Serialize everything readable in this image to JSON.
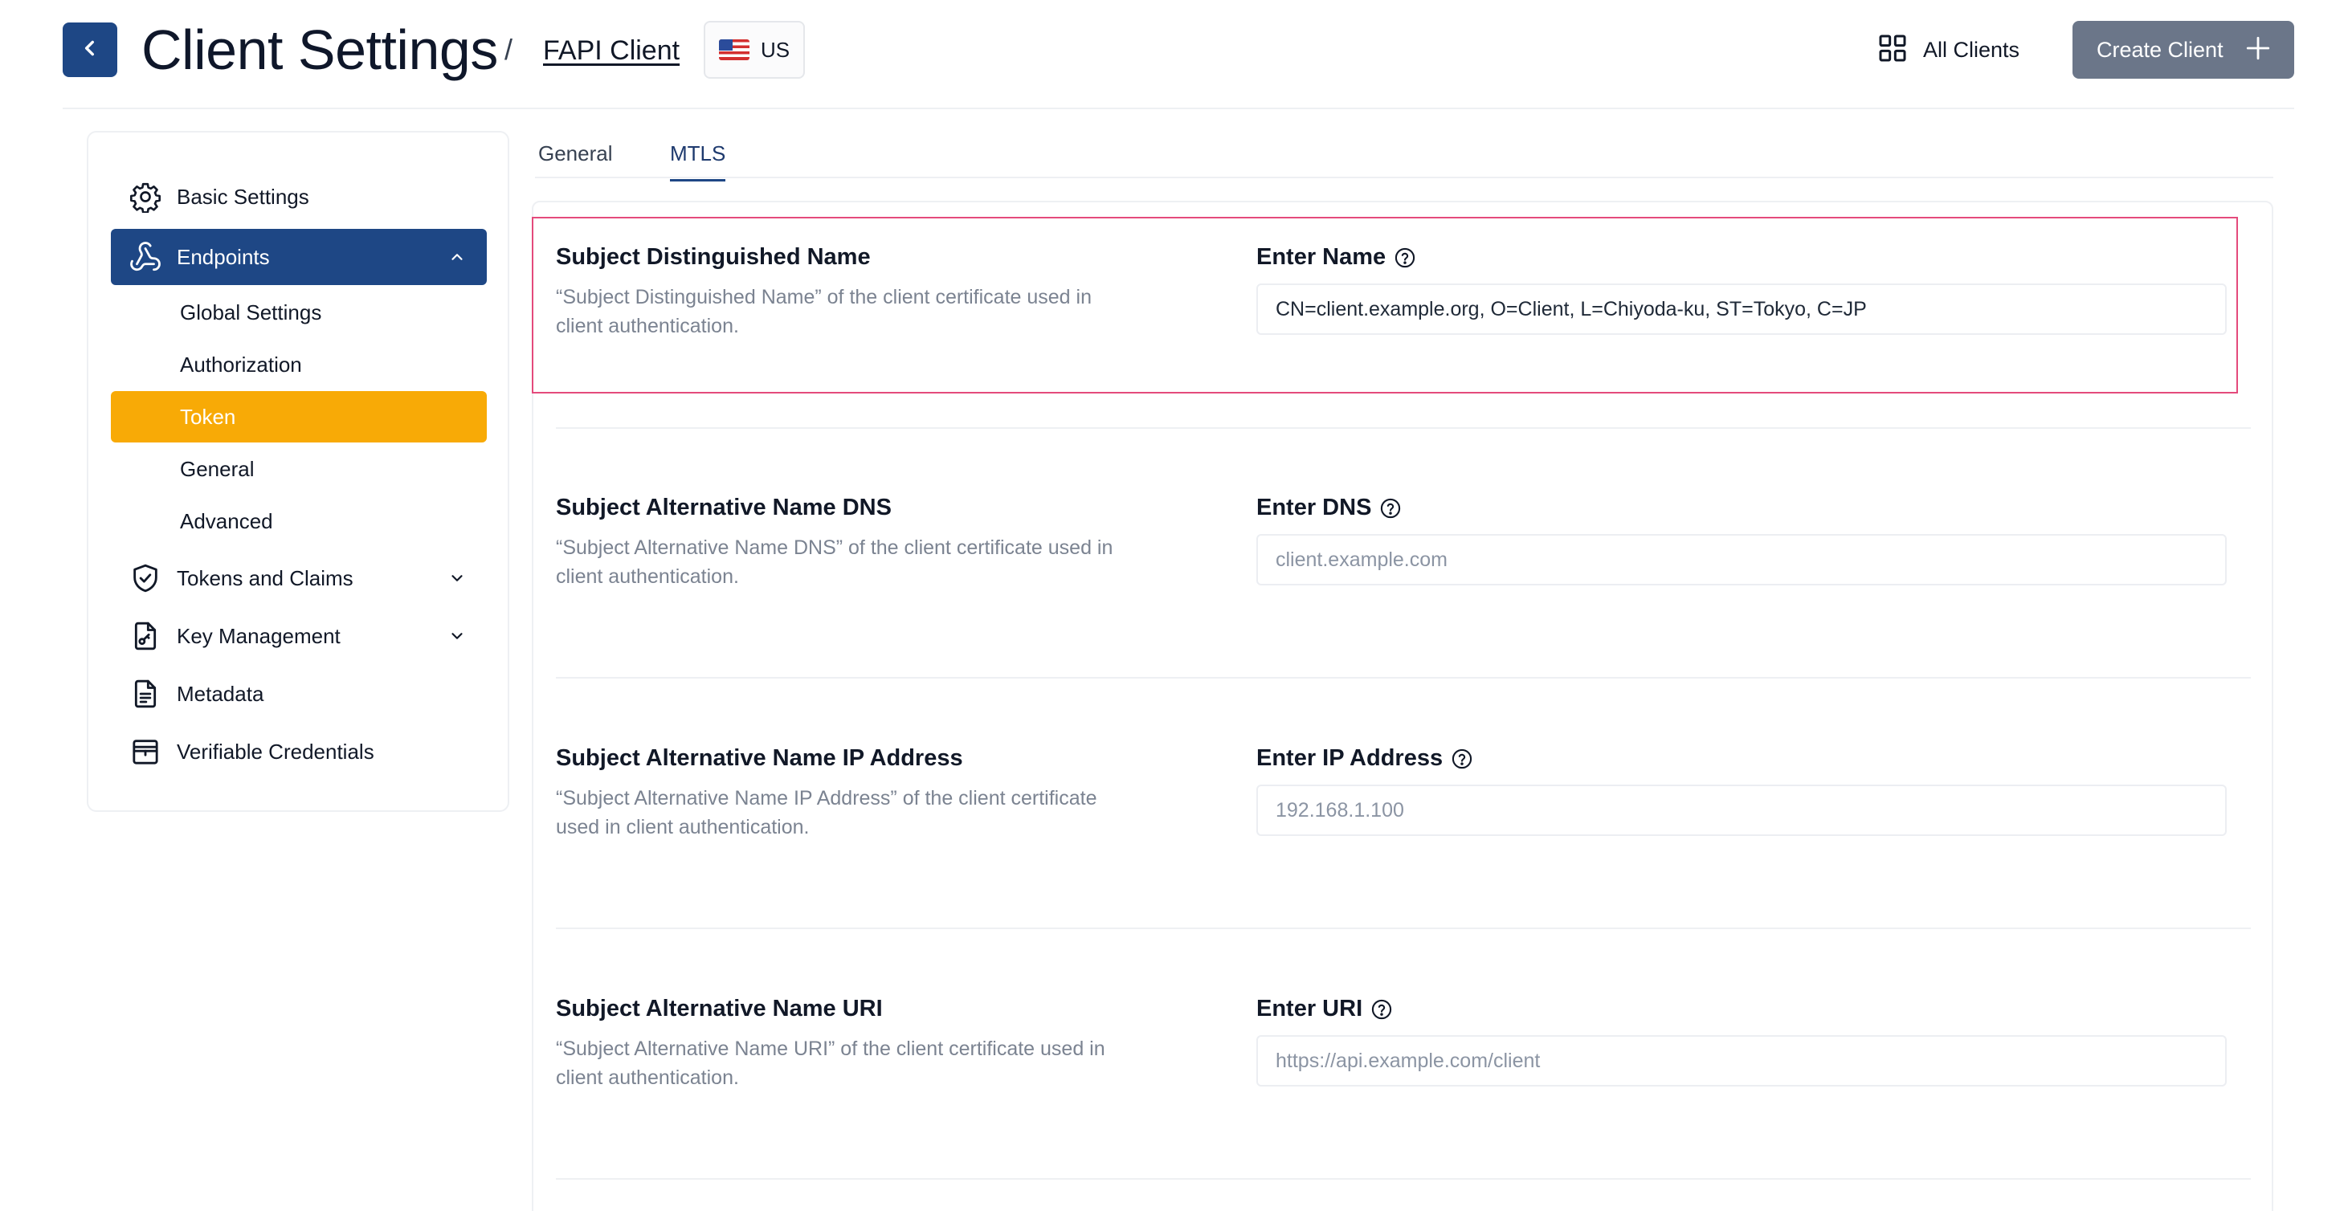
{
  "header": {
    "title": "Client Settings",
    "separator": "/",
    "client_name": "FAPI Client",
    "region": "US",
    "all_clients_label": "All Clients",
    "create_client_label": "Create Client"
  },
  "sidebar": {
    "basic_settings": "Basic Settings",
    "endpoints": "Endpoints",
    "endpoint_items": [
      "Global Settings",
      "Authorization",
      "Token",
      "General",
      "Advanced"
    ],
    "active_endpoint_item": "Token",
    "tokens_and_claims": "Tokens and Claims",
    "key_management": "Key Management",
    "metadata": "Metadata",
    "verifiable_credentials": "Verifiable Credentials"
  },
  "tabs": [
    {
      "label": "General",
      "active": false
    },
    {
      "label": "MTLS",
      "active": true
    }
  ],
  "sections": [
    {
      "title": "Subject Distinguished Name",
      "description": "“Subject Distinguished Name” of the client certificate used in client authentication.",
      "field_label": "Enter Name",
      "value": "CN=client.example.org, O=Client, L=Chiyoda-ku, ST=Tokyo, C=JP",
      "placeholder": ""
    },
    {
      "title": "Subject Alternative Name DNS",
      "description": "“Subject Alternative Name DNS” of the client certificate used in client authentication.",
      "field_label": "Enter DNS",
      "value": "",
      "placeholder": "client.example.com"
    },
    {
      "title": "Subject Alternative Name IP Address",
      "description": "“Subject Alternative Name IP Address” of the client certificate used in client authentication.",
      "field_label": "Enter IP Address",
      "value": "",
      "placeholder": "192.168.1.100"
    },
    {
      "title": "Subject Alternative Name URI",
      "description": "“Subject Alternative Name URI” of the client certificate used in client authentication.",
      "field_label": "Enter URI",
      "value": "",
      "placeholder": "https://api.example.com/client"
    }
  ],
  "colors": {
    "primary": "#1e4785",
    "accent": "#f8aa06",
    "highlight_border": "#e44a7c",
    "create_button": "#6b7689"
  },
  "icons": {
    "back": "chevron-left-icon",
    "all_clients": "grid-icon",
    "create": "plus-icon",
    "basic_settings": "gear-icon",
    "endpoints": "webhook-icon",
    "tokens_and_claims": "shield-check-icon",
    "key_management": "key-document-icon",
    "metadata": "document-text-icon",
    "verifiable_credentials": "wallet-icon",
    "help": "question-circle-icon"
  }
}
